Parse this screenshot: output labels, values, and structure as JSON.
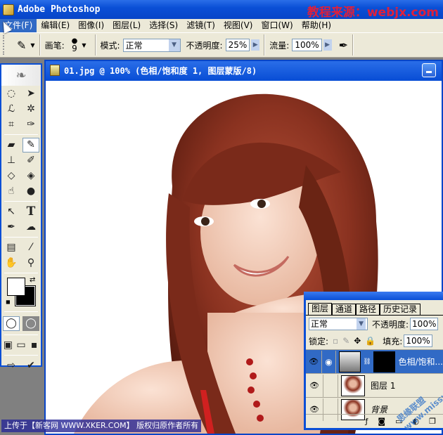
{
  "window": {
    "title": "Adobe Photoshop",
    "watermark": "教程来源：webjx.com"
  },
  "menu": {
    "items": [
      {
        "label": "文件(F)",
        "active": true
      },
      {
        "label": "编辑(E)"
      },
      {
        "label": "图像(I)"
      },
      {
        "label": "图层(L)"
      },
      {
        "label": "选择(S)"
      },
      {
        "label": "滤镜(T)"
      },
      {
        "label": "视图(V)"
      },
      {
        "label": "窗口(W)"
      },
      {
        "label": "帮助(H)"
      }
    ]
  },
  "options": {
    "brush_label": "画笔:",
    "brush_size": "9",
    "mode_label": "模式:",
    "mode_value": "正常",
    "opacity_label": "不透明度:",
    "opacity_value": "25%",
    "flow_label": "流量:",
    "flow_value": "100%"
  },
  "document": {
    "title": "01.jpg @ 100% (色相/饱和度 1, 图层蒙版/8)"
  },
  "layers_panel": {
    "tabs": [
      "图层",
      "通道",
      "路径",
      "历史记录"
    ],
    "blend_mode": "正常",
    "opacity_label": "不透明度:",
    "opacity_value": "100%",
    "lock_label": "锁定:",
    "fill_label": "填充:",
    "fill_value": "100%",
    "layers": [
      {
        "name": "色相/饱和...",
        "selected": true,
        "visible": true
      },
      {
        "name": "图层 1",
        "selected": false,
        "visible": true
      },
      {
        "name": "背景",
        "selected": false,
        "visible": true
      }
    ]
  },
  "footer": {
    "upload_text": "上传于【新客网 WWW.XKER.COM】 版权归原作者所有",
    "corner_watermark": "思缘联盟 www.missyuan.com"
  },
  "colors": {
    "foreground": "#ffffff",
    "background": "#000000",
    "titlebar": "#0a4fd6",
    "selection": "#316ac5"
  }
}
